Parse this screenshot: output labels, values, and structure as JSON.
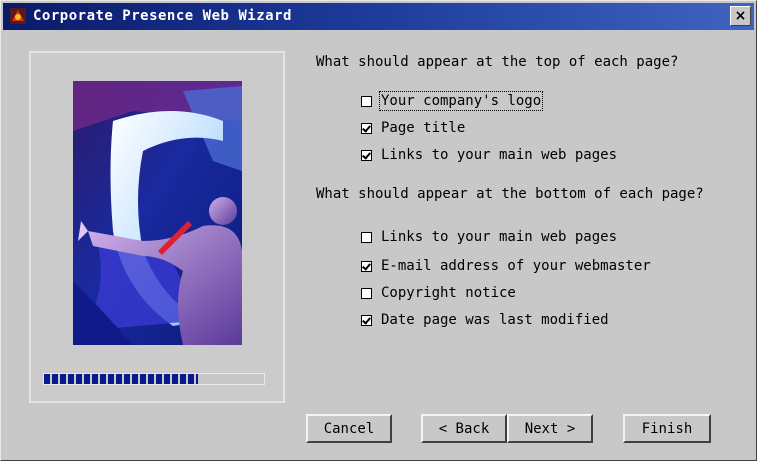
{
  "window": {
    "title": "Corporate Presence Web Wizard",
    "close_label": "×"
  },
  "progress": {
    "fraction": 0.7
  },
  "top_section": {
    "question": "What should appear at the top of each page?",
    "options": [
      {
        "label": "Your company's logo",
        "checked": false
      },
      {
        "label": "Page title",
        "checked": true
      },
      {
        "label": "Links to your main web pages",
        "checked": true
      }
    ]
  },
  "bottom_section": {
    "question": "What should appear at the bottom of each page?",
    "options": [
      {
        "label": "Links to your main web pages",
        "checked": false
      },
      {
        "label": "E-mail address of your webmaster",
        "checked": true
      },
      {
        "label": "Copyright notice",
        "checked": false
      },
      {
        "label": "Date page was last modified",
        "checked": true
      }
    ]
  },
  "buttons": {
    "cancel": "Cancel",
    "back": "< Back",
    "next": "Next >",
    "finish": "Finish"
  },
  "colors": {
    "titlebar": "#0a1a6a",
    "progress_fill": "#0a1a8a"
  },
  "icons": {
    "app": "wizard-app-icon",
    "close": "close-icon"
  }
}
